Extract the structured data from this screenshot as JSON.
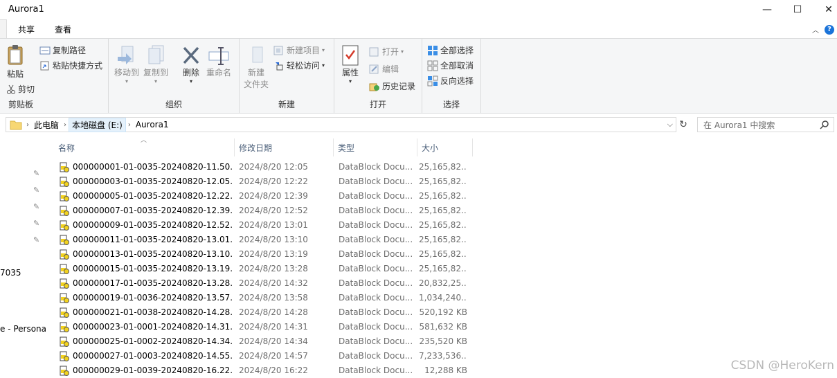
{
  "window": {
    "title": "Aurora1",
    "minimize": "—",
    "maximize": "☐",
    "close": "✕"
  },
  "tabs": [
    {
      "label": "共享"
    },
    {
      "label": "查看"
    }
  ],
  "ribbon": {
    "clipboard": {
      "label": "剪贴板",
      "paste": "粘贴",
      "copy_path": "复制路径",
      "paste_shortcut": "粘贴快捷方式",
      "cut": "剪切"
    },
    "organize": {
      "label": "组织",
      "move_to": "移动到",
      "copy_to": "复制到",
      "delete": "删除",
      "rename": "重命名"
    },
    "new": {
      "label": "新建",
      "new_folder_line1": "新建",
      "new_folder_line2": "文件夹",
      "new_item": "新建项目",
      "easy_access": "轻松访问"
    },
    "open": {
      "label": "打开",
      "properties": "属性",
      "open": "打开",
      "edit": "编辑",
      "history": "历史记录"
    },
    "select": {
      "label": "选择",
      "select_all": "全部选择",
      "select_none": "全部取消",
      "invert": "反向选择"
    }
  },
  "address": {
    "crumbs": [
      "此电脑",
      "本地磁盘 (E:)",
      "Aurora1"
    ]
  },
  "search": {
    "placeholder": "在 Aurora1 中搜索"
  },
  "nav": {
    "texts": [
      "7035",
      "e - Persona"
    ]
  },
  "columns": {
    "name": "名称",
    "date": "修改日期",
    "type": "类型",
    "size": "大小"
  },
  "files": [
    {
      "name": "000000001-01-0035-20240820-11.50....",
      "date": "2024/8/20 12:05",
      "type": "DataBlock Docu...",
      "size": "25,165,82..."
    },
    {
      "name": "000000003-01-0035-20240820-12.05....",
      "date": "2024/8/20 12:22",
      "type": "DataBlock Docu...",
      "size": "25,165,82..."
    },
    {
      "name": "000000005-01-0035-20240820-12.22....",
      "date": "2024/8/20 12:39",
      "type": "DataBlock Docu...",
      "size": "25,165,82..."
    },
    {
      "name": "000000007-01-0035-20240820-12.39....",
      "date": "2024/8/20 12:52",
      "type": "DataBlock Docu...",
      "size": "25,165,82..."
    },
    {
      "name": "000000009-01-0035-20240820-12.52....",
      "date": "2024/8/20 13:01",
      "type": "DataBlock Docu...",
      "size": "25,165,82..."
    },
    {
      "name": "000000011-01-0035-20240820-13.01....",
      "date": "2024/8/20 13:10",
      "type": "DataBlock Docu...",
      "size": "25,165,82..."
    },
    {
      "name": "000000013-01-0035-20240820-13.10....",
      "date": "2024/8/20 13:19",
      "type": "DataBlock Docu...",
      "size": "25,165,82..."
    },
    {
      "name": "000000015-01-0035-20240820-13.19....",
      "date": "2024/8/20 13:28",
      "type": "DataBlock Docu...",
      "size": "25,165,82..."
    },
    {
      "name": "000000017-01-0035-20240820-13.28....",
      "date": "2024/8/20 14:32",
      "type": "DataBlock Docu...",
      "size": "20,832,25..."
    },
    {
      "name": "000000019-01-0036-20240820-13.57....",
      "date": "2024/8/20 13:58",
      "type": "DataBlock Docu...",
      "size": "1,034,240..."
    },
    {
      "name": "000000021-01-0038-20240820-14.28....",
      "date": "2024/8/20 14:28",
      "type": "DataBlock Docu...",
      "size": "520,192 KB"
    },
    {
      "name": "000000023-01-0001-20240820-14.31....",
      "date": "2024/8/20 14:31",
      "type": "DataBlock Docu...",
      "size": "581,632 KB"
    },
    {
      "name": "000000025-01-0002-20240820-14.34....",
      "date": "2024/8/20 14:34",
      "type": "DataBlock Docu...",
      "size": "235,520 KB"
    },
    {
      "name": "000000027-01-0003-20240820-14.55....",
      "date": "2024/8/20 14:57",
      "type": "DataBlock Docu...",
      "size": "7,233,536..."
    },
    {
      "name": "000000029-01-0039-20240820-16.22....",
      "date": "2024/8/20 16:22",
      "type": "DataBlock Docu...",
      "size": "12,288 KB"
    }
  ],
  "watermark": "CSDN @HeroKern"
}
